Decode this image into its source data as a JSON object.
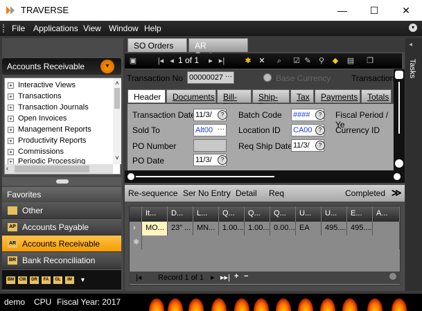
{
  "window": {
    "title": "TRAVERSE",
    "minimize_glyph": "—",
    "maximize_glyph": "☐",
    "close_glyph": "✕"
  },
  "menubar": {
    "items": [
      "File",
      "Applications",
      "View",
      "Window",
      "Help"
    ]
  },
  "left": {
    "module_title": "Accounts Receivable",
    "tree": [
      "Interactive Views",
      "Transactions",
      "Transaction Journals",
      "Open Invoices",
      "Management Reports",
      "Productivity Reports",
      "Commissions",
      "Periodic Processing"
    ],
    "favorites_title": "Favorites",
    "favorites": [
      {
        "label": "Other",
        "icon": "folder-icon",
        "tag": ""
      },
      {
        "label": "Accounts Payable",
        "icon": "ap-icon",
        "tag": "AP"
      },
      {
        "label": "Accounts Receivable",
        "icon": "ar-icon",
        "tag": "AR"
      },
      {
        "label": "Bank Reconciliation",
        "icon": "br-icon",
        "tag": "BR"
      }
    ],
    "bottom_icons": [
      "BM",
      "CM",
      "DR",
      "FA",
      "GL",
      "IM"
    ]
  },
  "doc_tabs": [
    "SO Orders",
    "AR Customers"
  ],
  "right_bar_label": "Tasks",
  "toolbar": {
    "record_nav": "1 of 1"
  },
  "form": {
    "transaction_no_label": "Transaction No",
    "transaction_no_value": "00000027",
    "base_currency_label": "Base Currency",
    "transaction_label_right": "Transaction",
    "tabs": [
      "Header",
      "Documents",
      "Bill-To",
      "Ship-To",
      "Tax",
      "Payments",
      "Totals"
    ],
    "fields": {
      "transaction_date_label": "Transaction Date",
      "transaction_date_value": "11/3/",
      "batch_code_label": "Batch Code",
      "batch_code_value": "####",
      "fiscal_period_label": "Fiscal Period / Ye",
      "sold_to_label": "Sold To",
      "sold_to_value": "Alt00",
      "location_id_label": "Location ID",
      "location_id_value": "CA00",
      "currency_id_label": "Currency ID",
      "po_number_label": "PO Number",
      "po_number_value": "",
      "req_ship_date_label": "Req Ship Date",
      "req_ship_date_value": "11/3/",
      "po_date_label": "PO Date",
      "po_date_value": "11/3/"
    }
  },
  "command_bar": {
    "items": [
      "Re-sequence",
      "Ser No Entry",
      "Detail",
      "Req"
    ],
    "completed": "Completed",
    "more": "≫"
  },
  "grid": {
    "headers": [
      "It...",
      "D...",
      "L...",
      "Q...",
      "Q...",
      "Q...",
      "U...",
      "U...",
      "E...",
      "A..."
    ],
    "row": [
      "MO...",
      "23\" ...",
      "MN...",
      "1.00...",
      "1.00...",
      "0.00...",
      "EA",
      "495....",
      "495....",
      ""
    ],
    "nav_text": "Record 1 of 1"
  },
  "status": {
    "user": "demo",
    "company": "CPU",
    "fiscal_year": "Fiscal Year: 2017"
  },
  "colors": {
    "accent_orange": "#f59b00",
    "dark": "#1a1a1a",
    "blue_text": "#1a3ee8"
  }
}
